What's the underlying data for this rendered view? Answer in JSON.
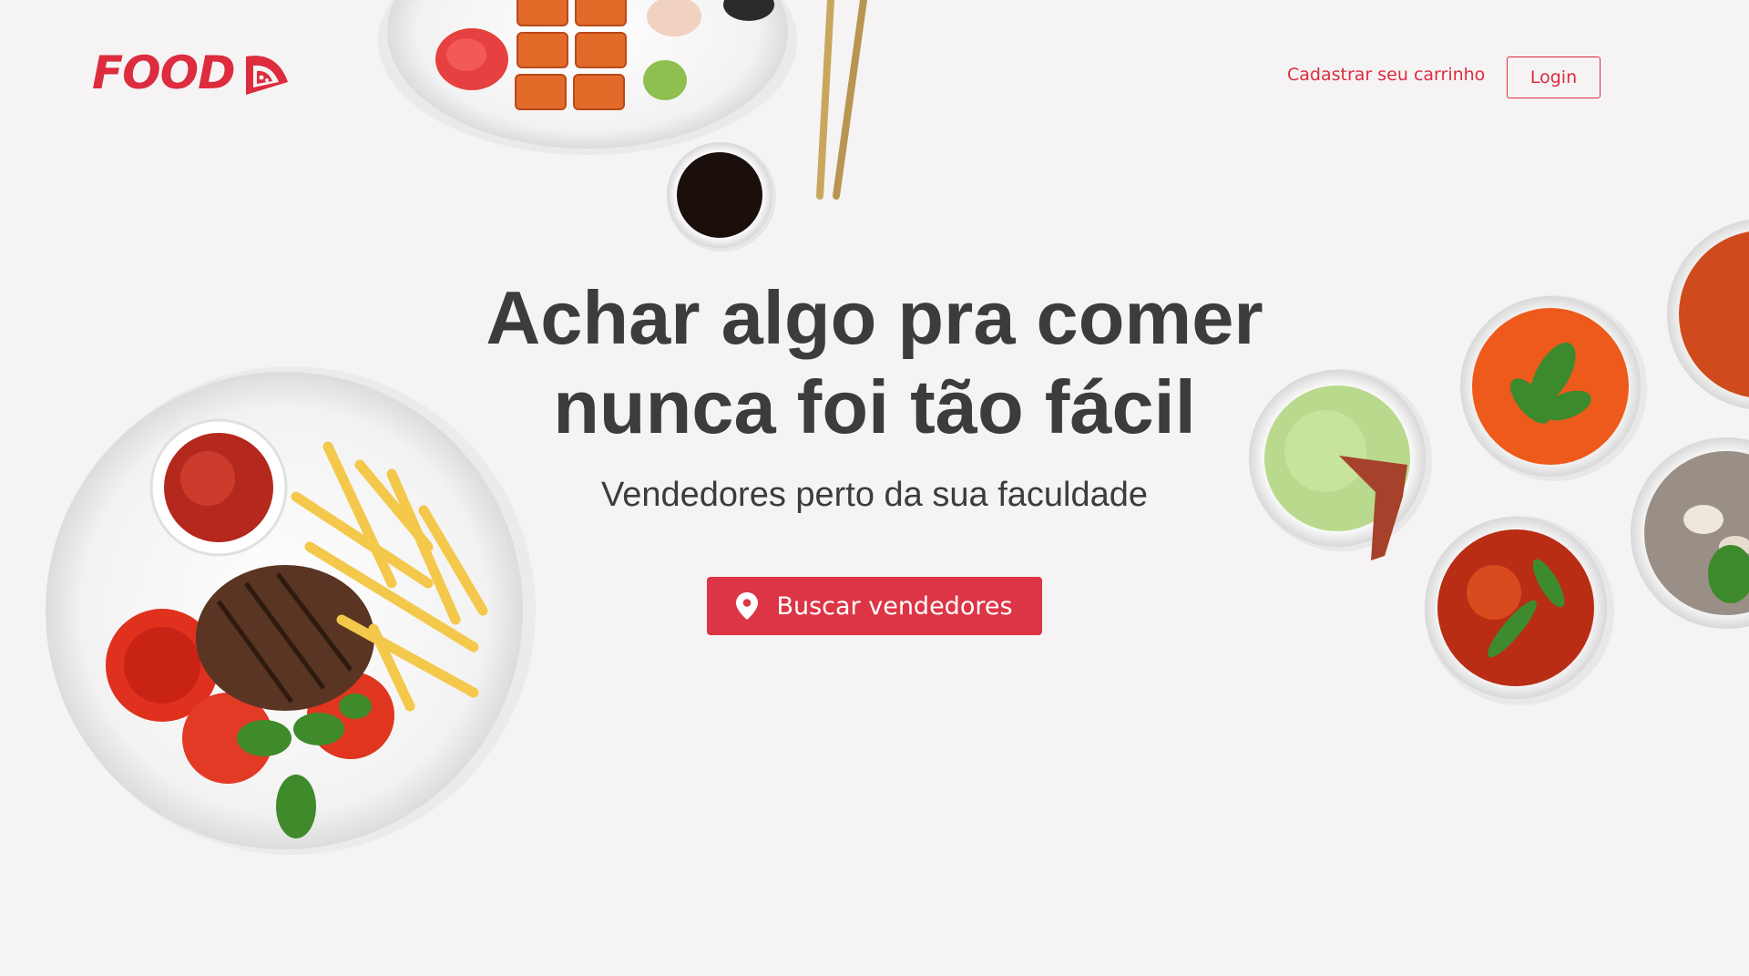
{
  "header": {
    "logo_text": "FOOD",
    "register_link": "Cadastrar seu carrinho",
    "login_label": "Login"
  },
  "hero": {
    "title_line1": "Achar algo pra comer",
    "title_line2": "nunca foi tão fácil",
    "subtitle": "Vendedores perto da sua faculdade",
    "cta_label": "Buscar vendedores"
  },
  "icons": {
    "logo": "pizza-slice-icon",
    "cta": "map-pin-icon"
  },
  "colors": {
    "accent": "#dc3545",
    "brand": "#dc2c3e",
    "background": "#f5f3f4",
    "text": "#3c3c3c"
  }
}
